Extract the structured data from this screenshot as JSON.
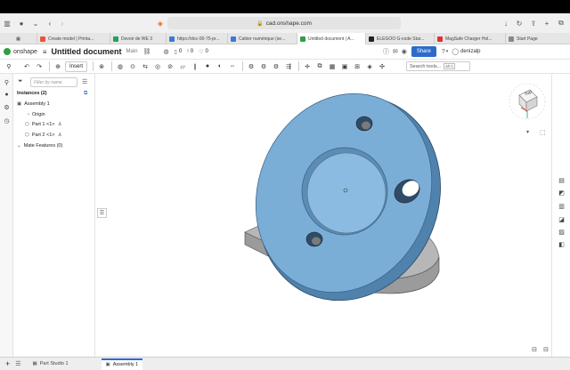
{
  "browser": {
    "url": "cad.onshape.com",
    "tabs": [
      {
        "label": "Create model | Printa...",
        "color": "#e8563a"
      },
      {
        "label": "Devoir de WE 3",
        "color": "#22a35a"
      },
      {
        "label": "https://doc-00-75-pr...",
        "color": "#3a7bd5"
      },
      {
        "label": "Cahier numérique (se...",
        "color": "#3a7bd5"
      },
      {
        "label": "Untitled document | A...",
        "color": "#2f9e44"
      },
      {
        "label": "ELEGOO G-code Star...",
        "color": "#222222"
      },
      {
        "label": "MagSafe Charger Hol...",
        "color": "#e03131"
      },
      {
        "label": "Start Page",
        "color": "#888888"
      }
    ]
  },
  "app": {
    "logo": "onshape",
    "doc_title": "Untitled document",
    "branch": "Main",
    "count_a": "0",
    "count_b": "0",
    "count_c": "0",
    "share": "Share",
    "user": "denizalp",
    "insert": "Insert",
    "search_tools": "Search tools...",
    "search_shortcut": "alt C"
  },
  "panel": {
    "filter_placeholder": "Filter by name",
    "instances": "Instances (2)",
    "assembly": "Assembly 1",
    "origin": "Origin",
    "part1": "Part 1 <1>",
    "part2": "Part 2 <1>",
    "mate_features": "Mate Features (0)"
  },
  "viewcube": {
    "face": "Top"
  },
  "bottom_tabs": [
    {
      "label": "Part Studio 1",
      "active": false
    },
    {
      "label": "Assembly 1",
      "active": true
    }
  ],
  "colors": {
    "accent": "#2b6cc9",
    "part_blue": "#7aaed6",
    "part_gray": "#9b9b9b"
  }
}
